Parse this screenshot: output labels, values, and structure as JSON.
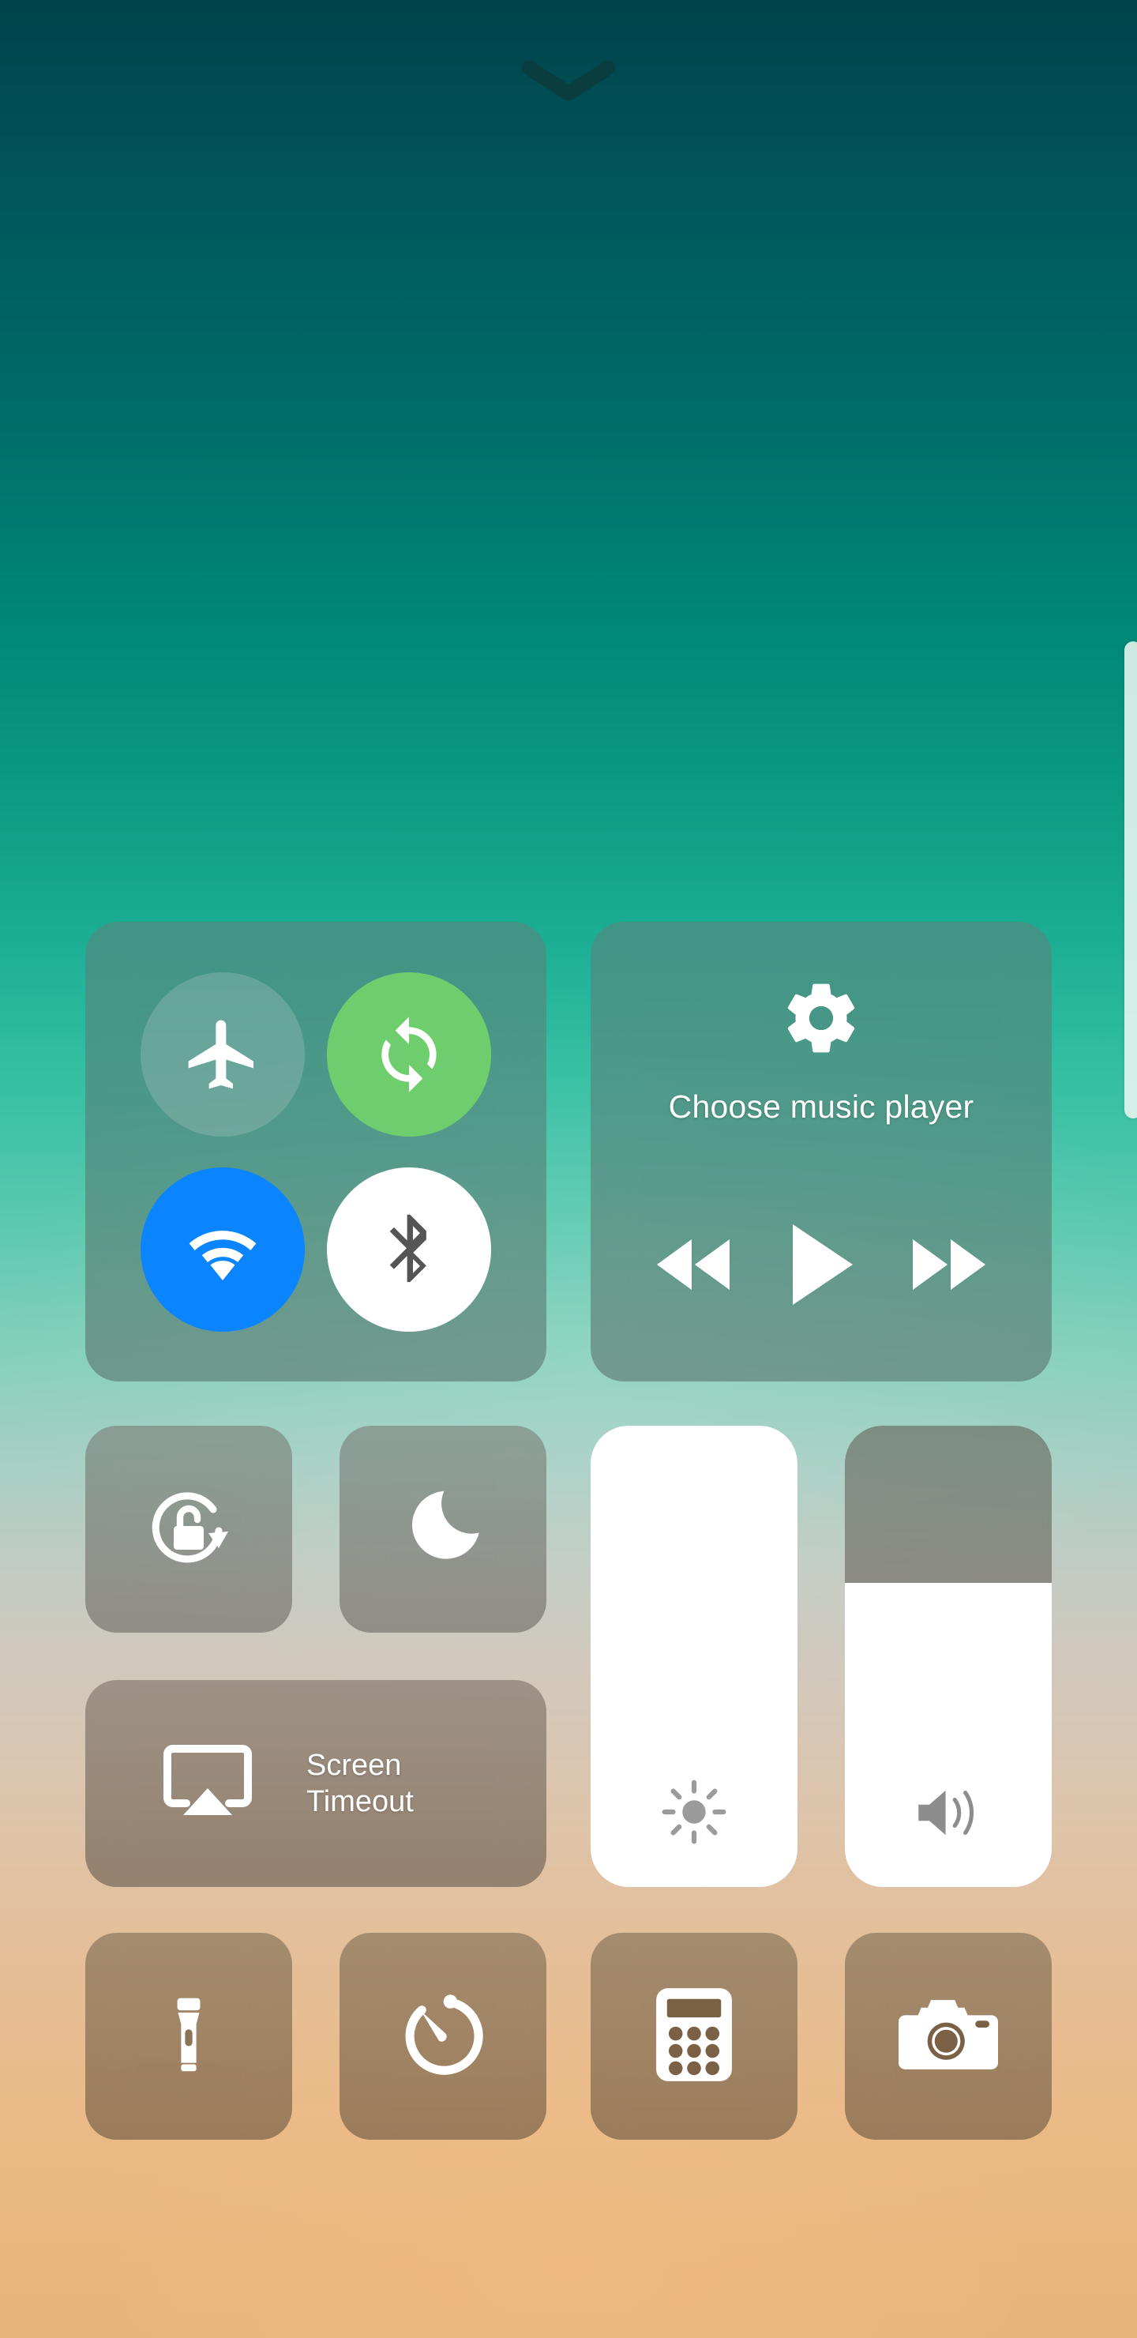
{
  "wallpaper": {
    "gradient_top": "#00424a",
    "gradient_mid": "#1bae94",
    "gradient_bottom": "#e8b67c"
  },
  "handle": {
    "icon": "chevron-down-icon",
    "color": "#0b3c3f"
  },
  "page_indicator": {
    "name": "page-scroll-indicator",
    "color": "#e9f6f2"
  },
  "connectivity": {
    "toggles": [
      {
        "name": "airplane-mode",
        "icon": "airplane-icon",
        "state": "off",
        "bg": "#b4c8c44d",
        "fg": "#ffffff"
      },
      {
        "name": "mobile-data",
        "icon": "sync-icon",
        "state": "on",
        "bg": "#6ece6e",
        "fg": "#ffffff"
      },
      {
        "name": "wifi",
        "icon": "wifi-icon",
        "state": "on",
        "bg": "#0a84ff",
        "fg": "#ffffff"
      },
      {
        "name": "bluetooth",
        "icon": "bluetooth-icon",
        "state": "on",
        "bg": "#ffffff",
        "fg": "#555555"
      }
    ]
  },
  "music": {
    "settings_icon": "gear-icon",
    "title": "Choose music player",
    "controls": [
      {
        "name": "previous-track",
        "icon": "rewind-icon"
      },
      {
        "name": "play",
        "icon": "play-icon"
      },
      {
        "name": "next-track",
        "icon": "fast-forward-icon"
      }
    ]
  },
  "quick_tiles": {
    "rotation_lock": {
      "icon": "rotation-lock-icon",
      "state": "unlocked"
    },
    "do_not_disturb": {
      "icon": "moon-icon",
      "state": "off"
    },
    "screen_timeout": {
      "icon": "screen-cast-icon",
      "label_line1": "Screen",
      "label_line2": "Timeout"
    }
  },
  "sliders": {
    "brightness": {
      "name": "brightness-slider",
      "icon": "sun-icon",
      "value": 100,
      "unit": "%"
    },
    "volume": {
      "name": "volume-slider",
      "icon": "speaker-icon",
      "value": 66,
      "unit": "%"
    }
  },
  "shortcuts": [
    {
      "name": "flashlight",
      "icon": "flashlight-icon"
    },
    {
      "name": "timer",
      "icon": "timer-icon"
    },
    {
      "name": "calculator",
      "icon": "calculator-icon"
    },
    {
      "name": "camera",
      "icon": "camera-icon"
    }
  ]
}
